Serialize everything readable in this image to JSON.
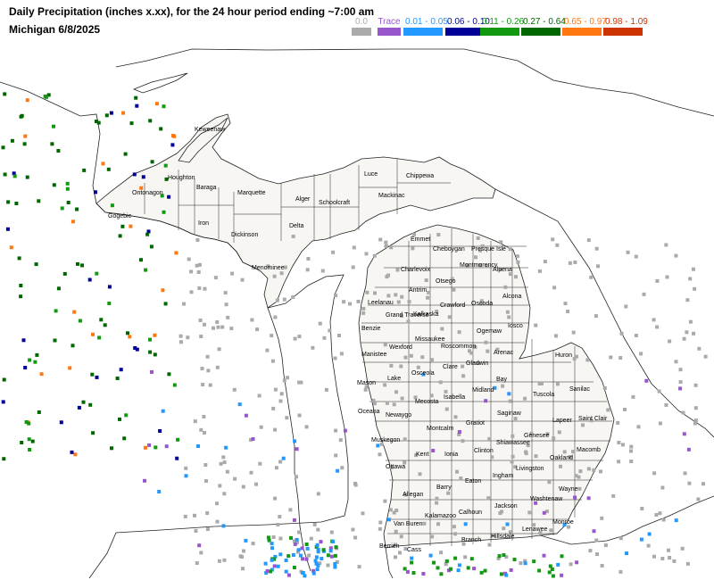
{
  "header": {
    "title": "Daily Precipitation (inches  x.xx),  for the 24 hour period ending ~7:00 am",
    "subtitle": "Michigan 6/8/2025"
  },
  "legend": [
    {
      "label": "0.0",
      "color": "#aaaaaa"
    },
    {
      "label": "Trace",
      "color": "#9955cc"
    },
    {
      "label": "0.01 - 0.05",
      "color": "#2299ff"
    },
    {
      "label": "0.06 - 0.10",
      "color": "#000099"
    },
    {
      "label": "0.11 - 0.26",
      "color": "#119911"
    },
    {
      "label": "0.27 - 0.64",
      "color": "#006600"
    },
    {
      "label": "0.65 - 0.97",
      "color": "#ff7711"
    },
    {
      "label": "0.98 - 1.09",
      "color": "#cc3300"
    }
  ],
  "counties": [
    "Keweenaw",
    "Houghton",
    "Baraga",
    "Ontonagon",
    "Gogebic",
    "Iron",
    "Marquette",
    "Alger",
    "Schoolcraft",
    "Luce",
    "Chippewa",
    "Mackinac",
    "Delta",
    "Dickinson",
    "Menominee",
    "Emmet",
    "Cheboygan",
    "Presque Isle",
    "Charlevoix",
    "Otsego",
    "Montmorency",
    "Alpena",
    "Antrim",
    "Leelanau",
    "Kalkaska",
    "Crawford",
    "Oscoda",
    "Alcona",
    "Grand Traverse",
    "Benzie",
    "Missaukee",
    "Roscommon",
    "Ogemaw",
    "Iosco",
    "Wexford",
    "Manistee",
    "Arenac",
    "Huron",
    "Osceola",
    "Clare",
    "Gladwin",
    "Bay",
    "Mason",
    "Lake",
    "Midland",
    "Tuscola",
    "Sanilac",
    "Isabella",
    "Oceana",
    "Newaygo",
    "Mecosta",
    "Saginaw",
    "Gratiot",
    "Lapeer",
    "Saint Clair",
    "Genesee",
    "Montcalm",
    "Muskegon",
    "Shiawassee",
    "Kent",
    "Ionia",
    "Clinton",
    "Macomb",
    "Ottawa",
    "Oakland",
    "Livingston",
    "Ingham",
    "Eaton",
    "Barry",
    "Allegan",
    "Wayne",
    "Washtenaw",
    "Jackson",
    "Calhoun",
    "Kalamazoo",
    "Van Buren",
    "Monroe",
    "Lenawee",
    "Hillsdale",
    "Branch",
    "Berrien",
    "Cass"
  ]
}
